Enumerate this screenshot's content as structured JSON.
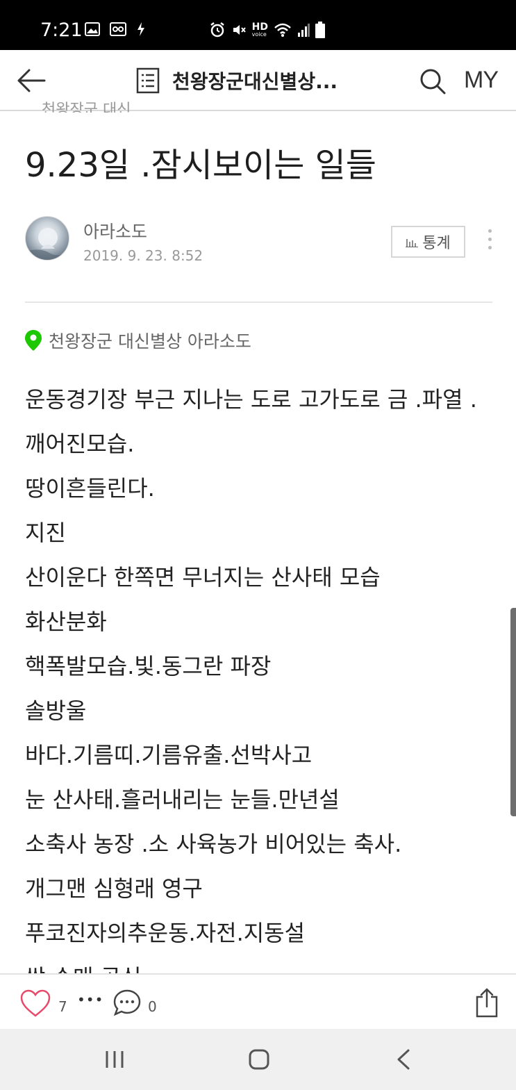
{
  "status_bar": {
    "time": "7:21",
    "left_icons": [
      "image-icon",
      "voicemail-icon",
      "bolt-icon"
    ],
    "right_icons": [
      "alarm-icon",
      "mute-icon",
      "hd-voice-icon",
      "wifi-icon",
      "signal-icon",
      "battery-icon"
    ],
    "hd_label": "HD",
    "voice_label": "voice"
  },
  "header": {
    "title": "천왕장군대신별상...",
    "my_label": "MY",
    "category_cut": "천왕장군 대신"
  },
  "post": {
    "title": "9.23일 .잠시보이는 일들",
    "author": "아라소도",
    "date": "2019. 9. 23. 8:52",
    "stats_label": "통계",
    "location": "천왕장군 대신별상 아라소도",
    "lines": [
      "운동경기장 부근  지나는 도로 고가도로 금 .파열 .깨어진모습.",
      "땅이흔들린다.",
      "지진",
      "산이운다 한쪽면 무너지는 산사태 모습",
      "화산분화",
      "핵폭발모습.빛.동그란 파장",
      "솔방울",
      "바다.기름띠.기름유출.선박사고",
      "눈 산사태.흘러내리는 눈들.만년설",
      "소축사 농장 .소 사육농가 비어있는 축사.",
      "개그맨 심형래 영구",
      "푸코진자의추운동.자전.지동설",
      "싹 수매 공식"
    ]
  },
  "actions": {
    "like_count": "7",
    "more": "•••",
    "comment_count": "0"
  },
  "colors": {
    "accent_green": "#1ec800",
    "like_pink": "#e8496b",
    "status_bar_bg": "#000000"
  }
}
